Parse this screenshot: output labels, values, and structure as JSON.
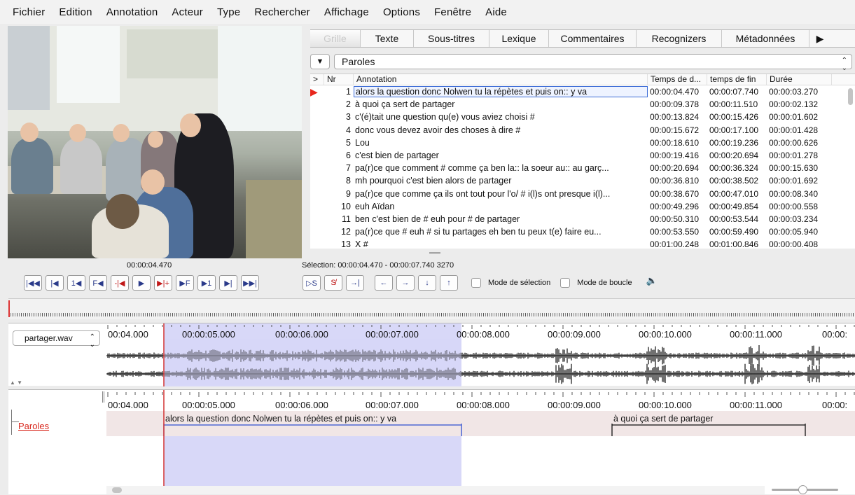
{
  "menu": [
    "Fichier",
    "Edition",
    "Annotation",
    "Acteur",
    "Type",
    "Rechercher",
    "Affichage",
    "Options",
    "Fenêtre",
    "Aide"
  ],
  "tabs": [
    "Grille",
    "Texte",
    "Sous-titres",
    "Lexique",
    "Commentaires",
    "Recognizers",
    "Métadonnées"
  ],
  "tier_selector": {
    "value": "Paroles"
  },
  "grid": {
    "headers": {
      "mark": ">",
      "nr": "Nr",
      "annotation": "Annotation",
      "start": "Temps de d...",
      "end": "temps de fin",
      "duration": "Durée"
    },
    "rows": [
      {
        "nr": "1",
        "text": "alors la question donc Nolwen tu la répètes et puis on::  y va",
        "start": "00:00:04.470",
        "end": "00:00:07.740",
        "dur": "00:00:03.270"
      },
      {
        "nr": "2",
        "text": "à quoi ça sert de partager",
        "start": "00:00:09.378",
        "end": "00:00:11.510",
        "dur": "00:00:02.132"
      },
      {
        "nr": "3",
        "text": "c'(é)tait une question qu(e) vous aviez choisi #",
        "start": "00:00:13.824",
        "end": "00:00:15.426",
        "dur": "00:00:01.602"
      },
      {
        "nr": "4",
        "text": " donc vous devez avoir des choses à dire  #",
        "start": "00:00:15.672",
        "end": "00:00:17.100",
        "dur": "00:00:01.428"
      },
      {
        "nr": "5",
        "text": "Lou",
        "start": "00:00:18.610",
        "end": "00:00:19.236",
        "dur": "00:00:00.626"
      },
      {
        "nr": "6",
        "text": "c'est bien de partager",
        "start": "00:00:19.416",
        "end": "00:00:20.694",
        "dur": "00:00:01.278"
      },
      {
        "nr": "7",
        "text": "pa(r)ce que comment  # comme ça ben la:: la soeur au:: au garç...",
        "start": "00:00:20.694",
        "end": "00:00:36.324",
        "dur": "00:00:15.630"
      },
      {
        "nr": "8",
        "text": "mh pourquoi c'est bien alors de partager",
        "start": "00:00:36.810",
        "end": "00:00:38.502",
        "dur": "00:00:01.692"
      },
      {
        "nr": "9",
        "text": "pa(r)ce que comme ça ils ont tout pour l'o/ # i(l)s ont presque i(l)...",
        "start": "00:00:38.670",
        "end": "00:00:47.010",
        "dur": "00:00:08.340"
      },
      {
        "nr": "10",
        "text": "euh Aïdan",
        "start": "00:00:49.296",
        "end": "00:00:49.854",
        "dur": "00:00:00.558"
      },
      {
        "nr": "11",
        "text": "ben c'est bien de  #  euh pour  #  de partager",
        "start": "00:00:50.310",
        "end": "00:00:53.544",
        "dur": "00:00:03.234"
      },
      {
        "nr": "12",
        "text": "pa(r)ce que  #  euh  #  si tu partages eh ben tu peux t(e) faire eu...",
        "start": "00:00:53.550",
        "end": "00:00:59.490",
        "dur": "00:00:05.940"
      },
      {
        "nr": "13",
        "text": "X #",
        "start": "00:01:00.248",
        "end": "00:01:00.846",
        "dur": "00:00:00.408"
      }
    ]
  },
  "media": {
    "current_time": "00:00:04.470",
    "selection": "Sélection: 00:00:04.470 - 00:00:07.740  3270",
    "mode_selection": "Mode de sélection",
    "mode_boucle": "Mode de boucle"
  },
  "wave": {
    "file": "partager.wav"
  },
  "ruler": [
    "00:04.000",
    "00:00:05.000",
    "00:00:06.000",
    "00:00:07.000",
    "00:00:08.000",
    "00:00:09.000",
    "00:00:10.000",
    "00:00:11.000",
    "00:00:"
  ],
  "tier": {
    "name": "Paroles",
    "annotations": [
      {
        "text": "alors la question donc Nolwen tu la répètes et puis on::  y va"
      },
      {
        "text": "à quoi ça sert de partager"
      }
    ]
  },
  "colors": {
    "selection": "#d8d8f8",
    "cursor": "#d33333",
    "tier_bg": "#f1e6e6",
    "annotation_line": "#2f4fd0"
  }
}
